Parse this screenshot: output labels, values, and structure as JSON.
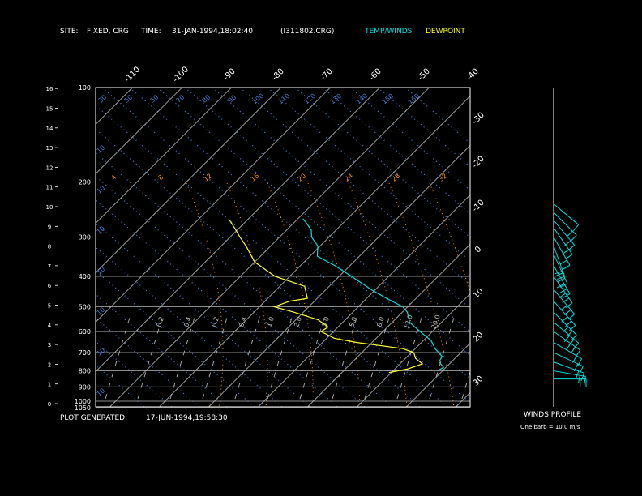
{
  "header": {
    "site_label": "SITE:",
    "site_value": "FIXED, CRG",
    "time_label": "TIME:",
    "time_value": "31-JAN-1994,18:02:40",
    "file": "(I311802.CRG)",
    "legend_temp": "TEMP/WINDS",
    "legend_dew": "DEWPOINT"
  },
  "footer": {
    "generated_label": "PLOT GENERATED:",
    "generated_value": "17-JUN-1994,19:58:30"
  },
  "wind_panel": {
    "title": "WINDS PROFILE",
    "note": "One barb = 10.0 m/s"
  },
  "colors": {
    "background": "#000000",
    "isobar": "#ffffff",
    "isotherm": "#ffffff",
    "dry_adiabat": "#4a7fd8",
    "moist_adiabat": "#ff8c1a",
    "mixing_ratio": "#a0a0a0",
    "temperature": "#00e0e0",
    "dewpoint": "#ffff30",
    "labels": "#ffffff"
  },
  "chart_data": {
    "type": "line",
    "pressure_levels": [
      100,
      200,
      300,
      400,
      500,
      600,
      700,
      800,
      900,
      1000,
      1050
    ],
    "height_km_ticks": [
      0,
      1,
      2,
      3,
      4,
      5,
      6,
      7,
      8,
      9,
      10,
      11,
      12,
      13,
      14,
      15,
      16
    ],
    "top_temp_ticks": [
      "-110",
      "-100",
      "-90",
      "-80",
      "-70",
      "-60",
      "-50",
      "-40"
    ],
    "right_temp_ticks": [
      "-30",
      "-20",
      "-10",
      "0",
      "10",
      "20",
      "30"
    ],
    "dry_adiabat_labels": [
      "30",
      "50",
      "50",
      "70",
      "80",
      "90",
      "100",
      "110",
      "120",
      "130",
      "140",
      "150",
      "160",
      "10",
      "10",
      "10",
      "10",
      "10",
      "10",
      "10"
    ],
    "moist_adiabat_labels": [
      "4",
      "8",
      "12",
      "16",
      "20",
      "24",
      "28",
      "32"
    ],
    "mixing_ratio_labels": [
      "0.2",
      "0.4",
      "0.2",
      "0.4",
      "1.0",
      "2.0",
      "3.0",
      "5.0",
      "8.0",
      "12.0",
      "20.0"
    ],
    "series": [
      {
        "name": "TEMP/WINDS",
        "points": [
          {
            "p": 800,
            "t": 9.0
          },
          {
            "p": 780,
            "t": 9.5
          },
          {
            "p": 750,
            "t": 7.5
          },
          {
            "p": 720,
            "t": 7.0
          },
          {
            "p": 680,
            "t": 4.0
          },
          {
            "p": 640,
            "t": 1.5
          },
          {
            "p": 600,
            "t": -2.5
          },
          {
            "p": 560,
            "t": -6.5
          },
          {
            "p": 520,
            "t": -9.0
          },
          {
            "p": 500,
            "t": -11.0
          },
          {
            "p": 470,
            "t": -16.0
          },
          {
            "p": 440,
            "t": -21.0
          },
          {
            "p": 400,
            "t": -27.5
          },
          {
            "p": 370,
            "t": -33.0
          },
          {
            "p": 345,
            "t": -38.5
          },
          {
            "p": 320,
            "t": -40.5
          },
          {
            "p": 300,
            "t": -43.5
          },
          {
            "p": 285,
            "t": -45.0
          },
          {
            "p": 270,
            "t": -47.5
          },
          {
            "p": 262,
            "t": -49.0
          }
        ]
      },
      {
        "name": "DEWPOINT",
        "points": [
          {
            "p": 810,
            "t": -0.5
          },
          {
            "p": 790,
            "t": 2.5
          },
          {
            "p": 760,
            "t": 4.5
          },
          {
            "p": 730,
            "t": 2.0
          },
          {
            "p": 700,
            "t": 0.5
          },
          {
            "p": 680,
            "t": -2.5
          },
          {
            "p": 650,
            "t": -13.0
          },
          {
            "p": 630,
            "t": -18.5
          },
          {
            "p": 600,
            "t": -22.5
          },
          {
            "p": 580,
            "t": -22.0
          },
          {
            "p": 550,
            "t": -25.5
          },
          {
            "p": 520,
            "t": -32.0
          },
          {
            "p": 500,
            "t": -37.0
          },
          {
            "p": 480,
            "t": -35.0
          },
          {
            "p": 470,
            "t": -32.0
          },
          {
            "p": 430,
            "t": -35.0
          },
          {
            "p": 400,
            "t": -43.0
          },
          {
            "p": 360,
            "t": -50.0
          },
          {
            "p": 320,
            "t": -55.0
          },
          {
            "p": 300,
            "t": -58.0
          },
          {
            "p": 280,
            "t": -61.0
          },
          {
            "p": 265,
            "t": -63.5
          }
        ]
      }
    ],
    "winds": [
      {
        "p": 850,
        "dir": 270,
        "speed": 15.0
      },
      {
        "p": 800,
        "dir": 260,
        "speed": 17.0
      },
      {
        "p": 750,
        "dir": 250,
        "speed": 20.0
      },
      {
        "p": 700,
        "dir": 245,
        "speed": 22.0
      },
      {
        "p": 650,
        "dir": 240,
        "speed": 24.0
      },
      {
        "p": 600,
        "dir": 235,
        "speed": 26.0
      },
      {
        "p": 560,
        "dir": 230,
        "speed": 28.0
      },
      {
        "p": 520,
        "dir": 225,
        "speed": 30.0
      },
      {
        "p": 480,
        "dir": 222,
        "speed": 32.0
      },
      {
        "p": 440,
        "dir": 220,
        "speed": 33.0
      },
      {
        "p": 400,
        "dir": 215,
        "speed": 32.0
      },
      {
        "p": 370,
        "dir": 210,
        "speed": 30.0
      },
      {
        "p": 340,
        "dir": 205,
        "speed": 26.0
      },
      {
        "p": 320,
        "dir": 200,
        "speed": 24.0
      },
      {
        "p": 300,
        "dir": 210,
        "speed": 22.0
      },
      {
        "p": 280,
        "dir": 215,
        "speed": 20.0
      },
      {
        "p": 265,
        "dir": 220,
        "speed": 18.0
      },
      {
        "p": 250,
        "dir": 225,
        "speed": 15.0
      },
      {
        "p": 235,
        "dir": 230,
        "speed": 12.0
      }
    ]
  }
}
